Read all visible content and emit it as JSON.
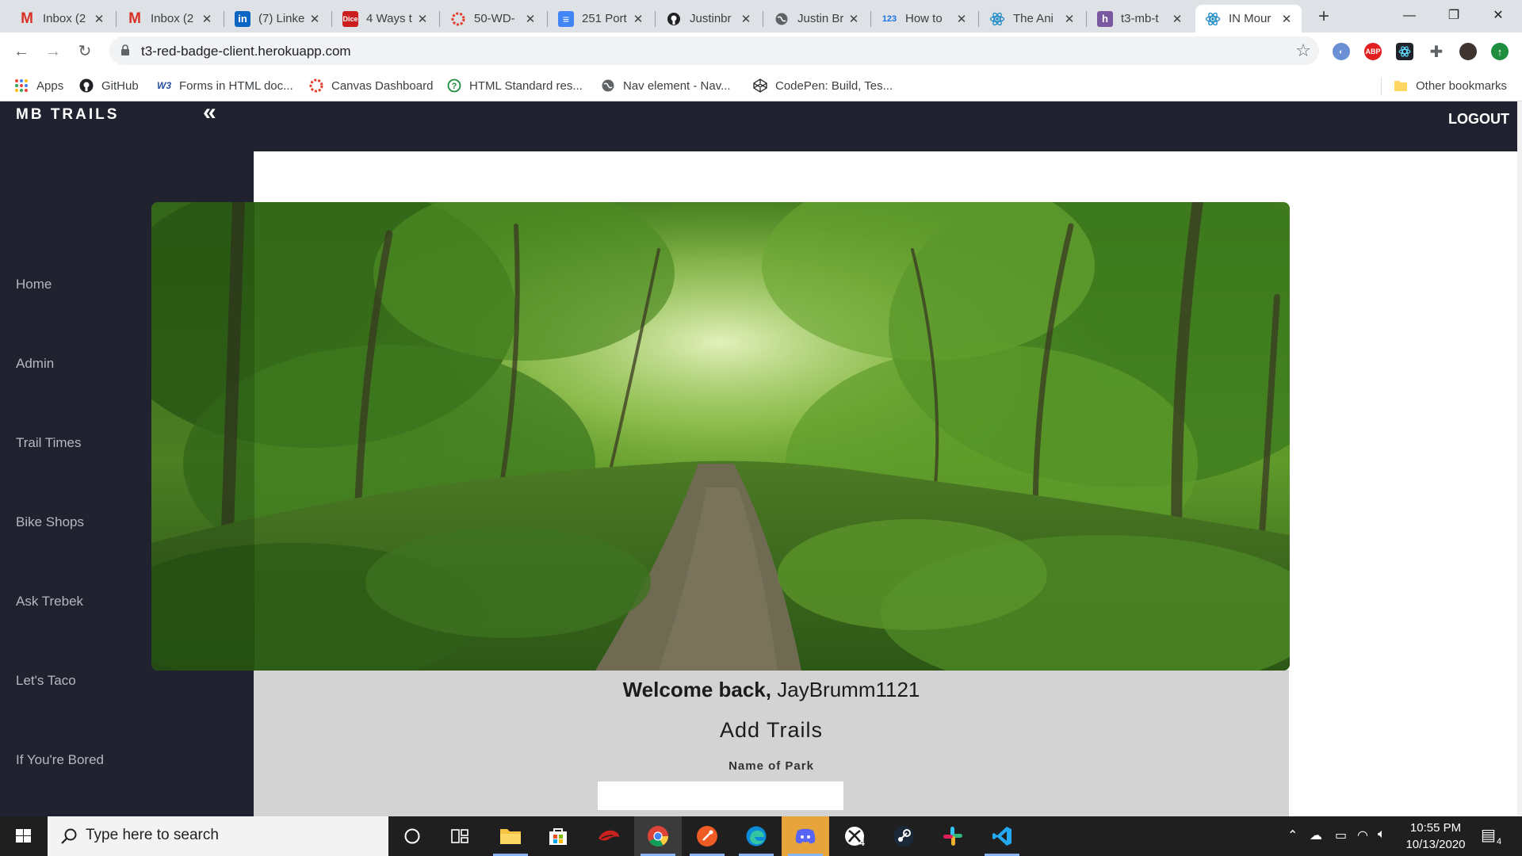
{
  "browser": {
    "tabs": [
      {
        "label": "Inbox (2",
        "favicon": "gmail-icon"
      },
      {
        "label": "Inbox (2",
        "favicon": "gmail-icon"
      },
      {
        "label": "(7) Linke",
        "favicon": "linkedin-icon"
      },
      {
        "label": "4 Ways t",
        "favicon": "dice-icon"
      },
      {
        "label": "50-WD-",
        "favicon": "canvas-icon"
      },
      {
        "label": "251 Port",
        "favicon": "docs-icon"
      },
      {
        "label": "Justinbr",
        "favicon": "github-icon"
      },
      {
        "label": "Justin Br",
        "favicon": "globe-icon"
      },
      {
        "label": "How to",
        "favicon": "123-icon"
      },
      {
        "label": "The Ani",
        "favicon": "react-icon"
      },
      {
        "label": "t3-mb-t",
        "favicon": "heroku-icon"
      },
      {
        "label": "IN Mour",
        "favicon": "react-icon",
        "active": true
      }
    ],
    "new_tab_label": "+",
    "window_controls": {
      "minimize": "—",
      "restore": "❐",
      "close": "✕"
    },
    "url": "t3-red-badge-client.herokuapp.com",
    "extensions": [
      "ABP"
    ],
    "bookmarks": [
      {
        "label": "Apps",
        "icon": "apps-grid-icon"
      },
      {
        "label": "GitHub",
        "icon": "github-icon"
      },
      {
        "label": "Forms in HTML doc...",
        "icon": "w3-icon"
      },
      {
        "label": "Canvas Dashboard",
        "icon": "canvas-icon"
      },
      {
        "label": "HTML Standard res...",
        "icon": "question-circle-icon"
      },
      {
        "label": "Nav element - Nav...",
        "icon": "globe-icon"
      },
      {
        "label": "CodePen: Build, Tes...",
        "icon": "codepen-icon"
      }
    ],
    "other_bookmarks": "Other bookmarks"
  },
  "app": {
    "brand": "MB TRAILS",
    "collapse_glyph": "«",
    "logout": "LOGOUT",
    "nav": [
      {
        "label": "Home"
      },
      {
        "label": "Admin"
      },
      {
        "label": "Trail Times"
      },
      {
        "label": "Bike Shops"
      },
      {
        "label": "Ask Trebek"
      },
      {
        "label": "Let's Taco"
      },
      {
        "label": "If You're Bored"
      }
    ],
    "welcome_prefix": "Welcome back,",
    "username": "JayBrumm1121",
    "form_title": "Add Trails",
    "park_label": "Name of Park",
    "park_value": "",
    "colors": {
      "header_bg": "#20232f",
      "form_bg": "#d3d3d3"
    }
  },
  "taskbar": {
    "search_placeholder": "Type here to search",
    "xbox_badge": "4",
    "time": "10:55 PM",
    "date": "10/13/2020",
    "notification_count": "4"
  }
}
